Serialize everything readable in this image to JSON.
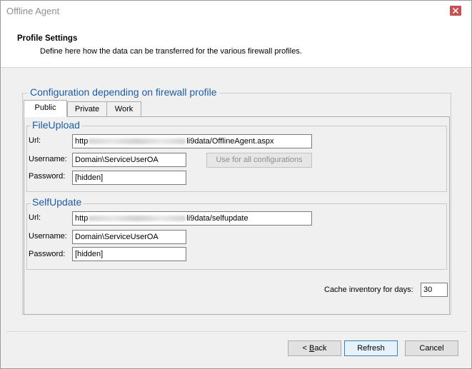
{
  "window": {
    "title": "Offline Agent"
  },
  "header": {
    "title": "Profile Settings",
    "description": "Define here how the data can be transferred for the various firewall profiles."
  },
  "config_group": {
    "title": "Configuration depending on firewall profile",
    "tabs": [
      {
        "label": "Public",
        "active": true
      },
      {
        "label": "Private",
        "active": false
      },
      {
        "label": "Work",
        "active": false
      }
    ]
  },
  "file_upload": {
    "title": "FileUpload",
    "url_label": "Url:",
    "url_prefix": "http",
    "url_suffix": "li9data/OfflineAgent.aspx",
    "username_label": "Username:",
    "username_value": "Domain\\ServiceUserOA",
    "password_label": "Password:",
    "password_value": "[hidden]",
    "use_for_all_label": "Use for all configurations"
  },
  "self_update": {
    "title": "SelfUpdate",
    "url_label": "Url:",
    "url_prefix": "http",
    "url_suffix": "li9data/selfupdate",
    "username_label": "Username:",
    "username_value": "Domain\\ServiceUserOA",
    "password_label": "Password:",
    "password_value": "[hidden]"
  },
  "cache": {
    "label": "Cache inventory for days:",
    "value": "30"
  },
  "footer": {
    "back_prefix": "< ",
    "back_underline": "B",
    "back_rest": "ack",
    "refresh_label": "Refresh",
    "cancel_label": "Cancel"
  },
  "colors": {
    "group_title": "#1e5ba8",
    "close_button": "#c75050"
  }
}
